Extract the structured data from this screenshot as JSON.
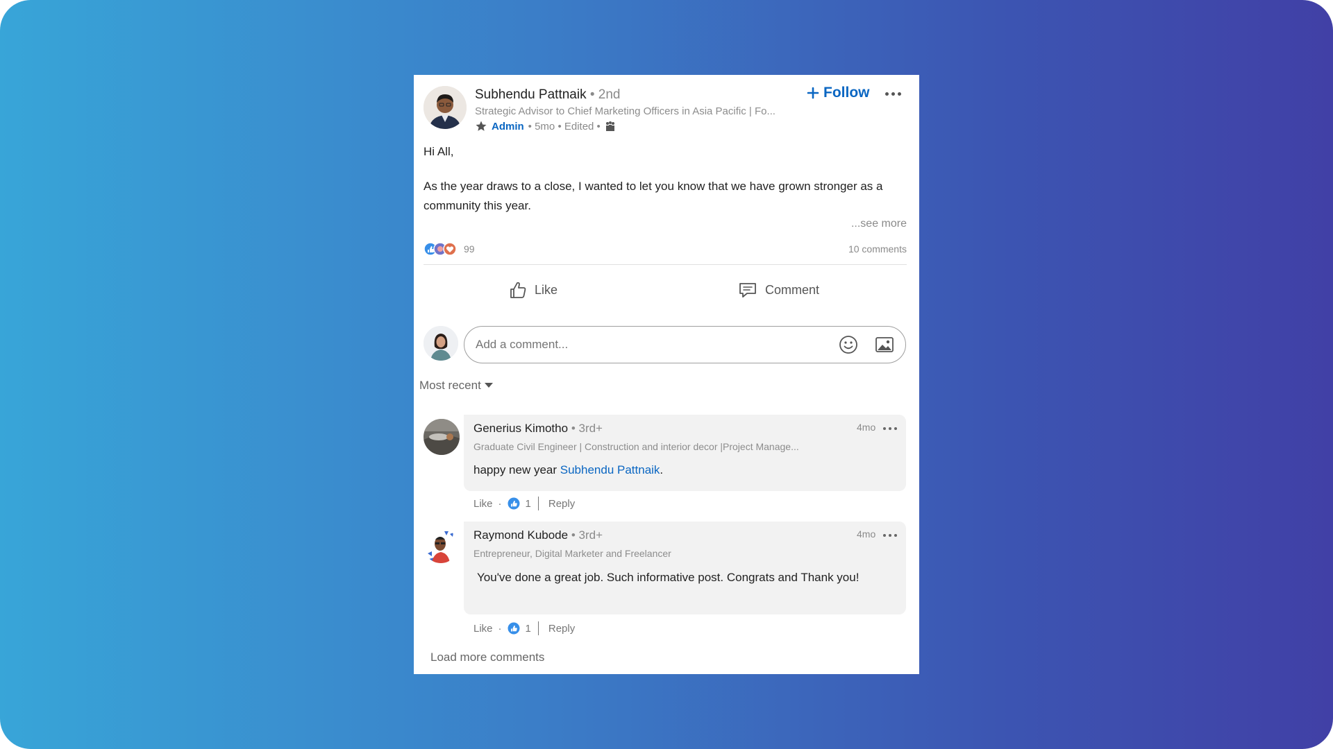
{
  "post": {
    "author": {
      "name": "Subhendu Pattnaik",
      "degree": "• 2nd",
      "headline": "Strategic Advisor to Chief Marketing Officers in Asia Pacific | Fo...",
      "role": "Admin",
      "meta": "• 5mo • Edited •"
    },
    "follow_label": "Follow",
    "body": {
      "greeting": "Hi All,",
      "paragraph": "As the year draws to a close, I wanted to let you know that we have grown stronger as a community this year.",
      "see_more": "...see more"
    },
    "reactions_count": "99",
    "comments_count": "10 comments",
    "like_label": "Like",
    "comment_label": "Comment"
  },
  "composer": {
    "placeholder": "Add a comment..."
  },
  "sort": {
    "label": "Most recent"
  },
  "comments": [
    {
      "name": "Generius Kimotho",
      "degree": "• 3rd+",
      "headline": "Graduate Civil Engineer | Construction and interior decor |Project Manage...",
      "time": "4mo",
      "text_before": "happy new year ",
      "mention": "Subhendu Pattnaik",
      "text_after": ".",
      "like_label": "Like",
      "dot": "·",
      "like_count": "1",
      "reply_label": "Reply"
    },
    {
      "name": "Raymond Kubode",
      "degree": "• 3rd+",
      "headline": "Entrepreneur, Digital Marketer and Freelancer",
      "time": "4mo",
      "text": "You've done a great job. Such informative post. Congrats and Thank you!",
      "like_label": "Like",
      "dot": "·",
      "like_count": "1",
      "reply_label": "Reply"
    }
  ],
  "load_more": "Load more comments",
  "colors": {
    "accent": "#0a66c2",
    "bubble": "#f2f2f2",
    "gradient_start": "#38a5d8",
    "gradient_end": "#4140a6"
  }
}
